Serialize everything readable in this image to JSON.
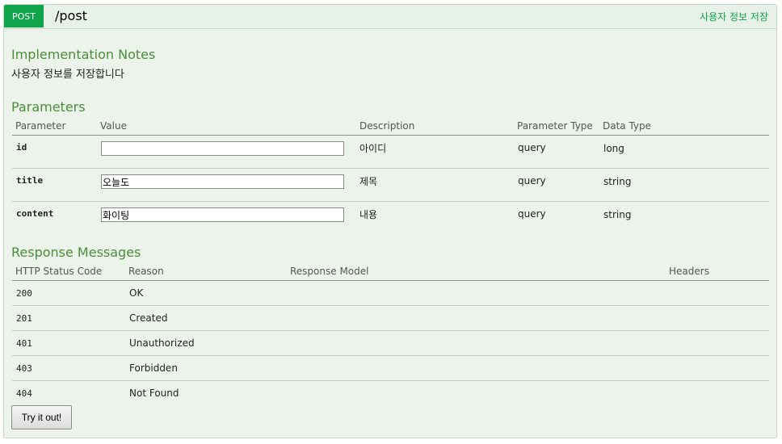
{
  "header": {
    "method": "POST",
    "path": "/post",
    "summary": "사용자 정보 저장"
  },
  "implementation_notes": {
    "title": "Implementation Notes",
    "text": "사용자 정보를 저장합니다"
  },
  "parameters": {
    "title": "Parameters",
    "columns": [
      "Parameter",
      "Value",
      "Description",
      "Parameter Type",
      "Data Type"
    ],
    "rows": [
      {
        "name": "id",
        "value": "",
        "description": "아이디",
        "param_type": "query",
        "data_type": "long"
      },
      {
        "name": "title",
        "value": "오늘도",
        "description": "제목",
        "param_type": "query",
        "data_type": "string"
      },
      {
        "name": "content",
        "value": "화이팅",
        "description": "내용",
        "param_type": "query",
        "data_type": "string"
      }
    ]
  },
  "responses": {
    "title": "Response Messages",
    "columns": [
      "HTTP Status Code",
      "Reason",
      "Response Model",
      "Headers"
    ],
    "rows": [
      {
        "code": "200",
        "reason": "OK"
      },
      {
        "code": "201",
        "reason": "Created"
      },
      {
        "code": "401",
        "reason": "Unauthorized"
      },
      {
        "code": "403",
        "reason": "Forbidden"
      },
      {
        "code": "404",
        "reason": "Not Found"
      }
    ]
  },
  "actions": {
    "try_label": "Try it out!"
  },
  "colors": {
    "method_badge": "#10a54a",
    "panel_bg": "#ebf3eb",
    "section_title": "#4b8e3a"
  }
}
